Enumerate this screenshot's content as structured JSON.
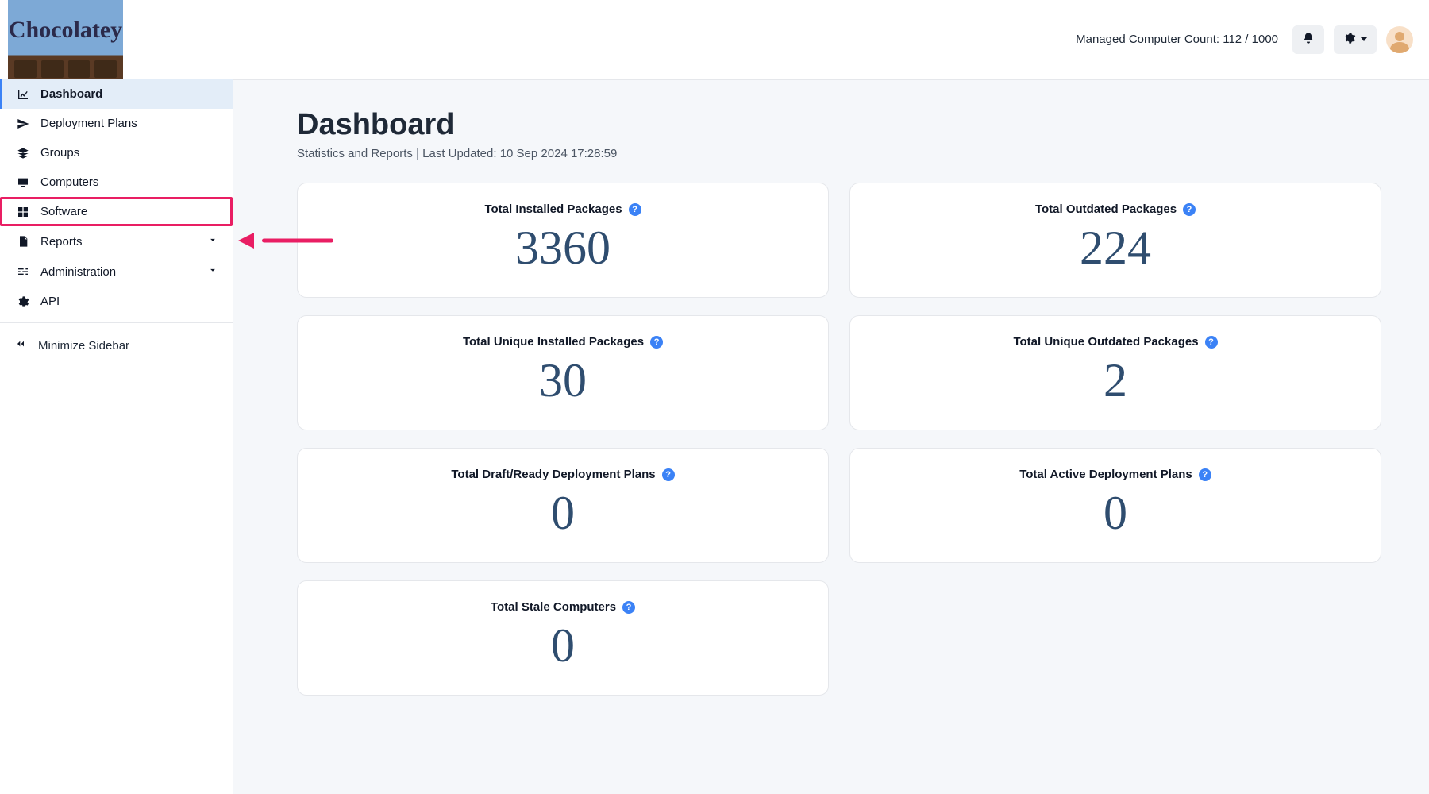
{
  "brand": "Chocolatey",
  "header": {
    "count_label": "Managed Computer Count: 112 / 1000"
  },
  "sidebar": {
    "items": [
      {
        "label": "Dashboard"
      },
      {
        "label": "Deployment Plans"
      },
      {
        "label": "Groups"
      },
      {
        "label": "Computers"
      },
      {
        "label": "Software"
      },
      {
        "label": "Reports"
      },
      {
        "label": "Administration"
      },
      {
        "label": "API"
      }
    ],
    "minimize_label": "Minimize Sidebar"
  },
  "page": {
    "title": "Dashboard",
    "subtitle_prefix": "Statistics and Reports | Last Updated: ",
    "last_updated": "10 Sep 2024 17:28:59"
  },
  "cards": {
    "installed_packages": {
      "title": "Total Installed Packages",
      "value": "3360"
    },
    "outdated_packages": {
      "title": "Total Outdated Packages",
      "value": "224"
    },
    "unique_installed_packages": {
      "title": "Total Unique Installed Packages",
      "value": "30"
    },
    "unique_outdated_packages": {
      "title": "Total Unique Outdated Packages",
      "value": "2"
    },
    "draft_ready_plans": {
      "title": "Total Draft/Ready Deployment Plans",
      "value": "0"
    },
    "active_plans": {
      "title": "Total Active Deployment Plans",
      "value": "0"
    },
    "stale_computers": {
      "title": "Total Stale Computers",
      "value": "0"
    }
  }
}
